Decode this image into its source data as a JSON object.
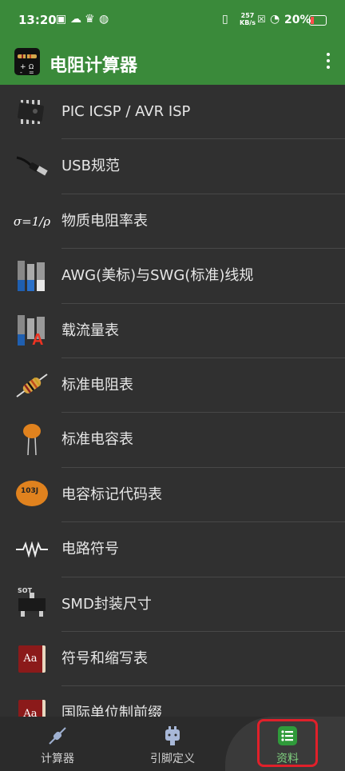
{
  "status": {
    "time": "13:20",
    "speed_top": "257",
    "speed_unit": "KB/s",
    "battery": "20%"
  },
  "app": {
    "title": "电阻计算器"
  },
  "items": [
    {
      "label": "PIC ICSP / AVR ISP"
    },
    {
      "label": "USB规范"
    },
    {
      "label": "物质电阻率表",
      "icon_text": "σ=1/ρ"
    },
    {
      "label": "AWG(美标)与SWG(标准)线规"
    },
    {
      "label": "载流量表",
      "icon_text": "A"
    },
    {
      "label": "标准电阻表"
    },
    {
      "label": "标准电容表"
    },
    {
      "label": "电容标记代码表",
      "icon_text": "103J"
    },
    {
      "label": "电路符号"
    },
    {
      "label": "SMD封装尺寸",
      "icon_text": "SOT"
    },
    {
      "label": "符号和缩写表",
      "icon_text": "Aa"
    },
    {
      "label": "国际单位制前缀",
      "icon_text": "Aa"
    }
  ],
  "nav": [
    {
      "label": "计算器"
    },
    {
      "label": "引脚定义"
    },
    {
      "label": "资料"
    }
  ],
  "colors": {
    "primary": "#3a8a3a",
    "background": "#303030",
    "highlight": "#e0202a"
  }
}
